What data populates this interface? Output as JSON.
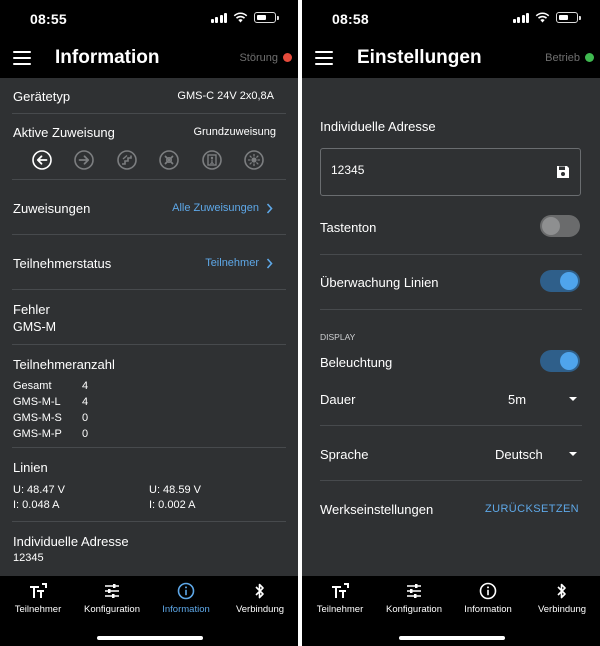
{
  "left": {
    "status_time": "08:55",
    "title": "Information",
    "status_text": "Störung",
    "status_color": "#e64b3c",
    "geraetetyp": {
      "label": "Gerätetyp",
      "value": "GMS-C 24V 2x0,8A"
    },
    "aktive_zuweisung": {
      "label": "Aktive Zuweisung",
      "value": "Grundzuweisung",
      "icons": [
        "arrow-left-circle-icon",
        "arrow-right-circle-icon",
        "stairs-circle-icon",
        "cross-circle-icon",
        "exit-door-circle-icon",
        "sun-circle-icon"
      ]
    },
    "zuweisungen": {
      "label": "Zuweisungen",
      "link": "Alle Zuweisungen"
    },
    "teilnehmerstatus": {
      "label": "Teilnehmerstatus",
      "link": "Teilnehmer"
    },
    "fehler": {
      "label": "Fehler",
      "value": "GMS-M"
    },
    "teilnehmeranzahl": {
      "label": "Teilnehmeranzahl",
      "rows": [
        {
          "name": "Gesamt",
          "count": "4"
        },
        {
          "name": "GMS-M-L",
          "count": "4"
        },
        {
          "name": "GMS-M-S",
          "count": "0"
        },
        {
          "name": "GMS-M-P",
          "count": "0"
        }
      ]
    },
    "linien": {
      "label": "Linien",
      "line1": {
        "u": "U: 48.47 V",
        "i": "I: 0.048 A"
      },
      "line2": {
        "u": "U: 48.59 V",
        "i": "I: 0.002 A"
      }
    },
    "adresse": {
      "label": "Individuelle Adresse",
      "value": "12345"
    }
  },
  "right": {
    "status_time": "08:58",
    "title": "Einstellungen",
    "status_text": "Betrieb",
    "status_color": "#3fb950",
    "adresse": {
      "label": "Individuelle Adresse",
      "value": "12345"
    },
    "tastenton": {
      "label": "Tastenton",
      "on": false
    },
    "ueberwachung": {
      "label": "Überwachung Linien",
      "on": true
    },
    "display_header": "DISPLAY",
    "beleuchtung": {
      "label": "Beleuchtung",
      "on": true
    },
    "dauer": {
      "label": "Dauer",
      "value": "5m"
    },
    "sprache": {
      "label": "Sprache",
      "value": "Deutsch"
    },
    "werkseinstellungen": {
      "label": "Werkseinstellungen",
      "action": "ZURÜCKSETZEN"
    }
  },
  "tabs": [
    {
      "label": "Teilnehmer",
      "icon": "participants-icon"
    },
    {
      "label": "Konfiguration",
      "icon": "sliders-icon"
    },
    {
      "label": "Information",
      "icon": "info-icon"
    },
    {
      "label": "Verbindung",
      "icon": "bluetooth-icon"
    }
  ],
  "colors": {
    "accent": "#5ea8e8",
    "background": "#2f3133",
    "bar": "#000000"
  }
}
